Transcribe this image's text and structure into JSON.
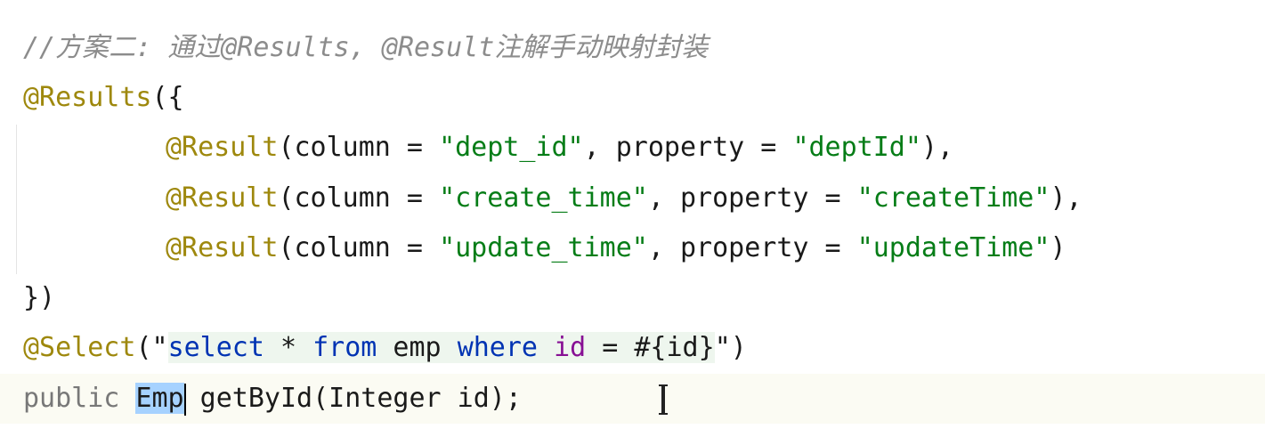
{
  "code": {
    "comment": "//方案二: 通过@Results, @Result注解手动映射封装",
    "results_open_anno": "@Results",
    "results_open_rest": "({",
    "result_rows": [
      {
        "anno": "@Result",
        "open": "(column = ",
        "column": "\"dept_id\"",
        "mid": ", property = ",
        "property": "\"deptId\"",
        "close": "),"
      },
      {
        "anno": "@Result",
        "open": "(column = ",
        "column": "\"create_time\"",
        "mid": ", property = ",
        "property": "\"createTime\"",
        "close": "),"
      },
      {
        "anno": "@Result",
        "open": "(column = ",
        "column": "\"update_time\"",
        "mid": ", property = ",
        "property": "\"updateTime\"",
        "close": ")"
      }
    ],
    "results_close": "})",
    "select_anno": "@Select",
    "select_open": "(\"",
    "sql_select": "select",
    "sql_star": " * ",
    "sql_from": "from",
    "sql_table": " emp ",
    "sql_where": "where",
    "sql_space": " ",
    "sql_id": "id",
    "sql_eq": " = #{id}",
    "select_close_quote": "\"",
    "select_close": ")",
    "method_modifier": "public",
    "method_space": " ",
    "method_return_type": "Emp",
    "method_rest": " getById(Integer id);"
  }
}
